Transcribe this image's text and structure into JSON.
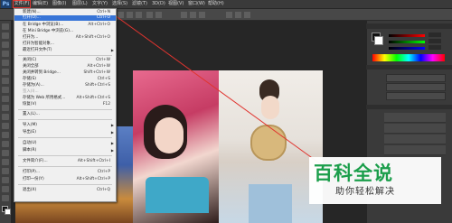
{
  "menubar": {
    "logo": "Ps",
    "items": [
      "文件(F)",
      "编辑(E)",
      "图像(I)",
      "图层(L)",
      "文字(Y)",
      "选择(S)",
      "滤镜(T)",
      "3D(D)",
      "视图(V)",
      "窗口(W)",
      "帮助(H)"
    ]
  },
  "file_menu": {
    "items": [
      {
        "label": "新建(N)...",
        "shortcut": "Ctrl+N"
      },
      {
        "label": "打开(O)...",
        "shortcut": "Ctrl+O"
      },
      {
        "label": "在 Bridge 中浏览(B)...",
        "shortcut": "Alt+Ctrl+O"
      },
      {
        "label": "在 Mini Bridge 中浏览(G)...",
        "shortcut": ""
      },
      {
        "label": "打开为...",
        "shortcut": "Alt+Shift+Ctrl+O"
      },
      {
        "label": "打开为智能对象...",
        "shortcut": ""
      },
      {
        "label": "最近打开文件(T)",
        "shortcut": ""
      },
      {
        "label": "关闭(C)",
        "shortcut": "Ctrl+W"
      },
      {
        "label": "关闭全部",
        "shortcut": "Alt+Ctrl+W"
      },
      {
        "label": "关闭并转到 Bridge...",
        "shortcut": "Shift+Ctrl+W"
      },
      {
        "label": "存储(S)",
        "shortcut": "Ctrl+S"
      },
      {
        "label": "存储为(A)...",
        "shortcut": "Shift+Ctrl+S"
      },
      {
        "label": "签入(I)...",
        "shortcut": ""
      },
      {
        "label": "存储为 Web 所用格式...",
        "shortcut": "Alt+Shift+Ctrl+S"
      },
      {
        "label": "恢复(V)",
        "shortcut": "F12"
      },
      {
        "label": "置入(L)...",
        "shortcut": ""
      },
      {
        "label": "导入(M)",
        "shortcut": ""
      },
      {
        "label": "导出(E)",
        "shortcut": ""
      },
      {
        "label": "自动(U)",
        "shortcut": ""
      },
      {
        "label": "脚本(R)",
        "shortcut": ""
      },
      {
        "label": "文件简介(F)...",
        "shortcut": "Alt+Shift+Ctrl+I"
      },
      {
        "label": "打印(P)...",
        "shortcut": "Ctrl+P"
      },
      {
        "label": "打印一份(Y)",
        "shortcut": "Alt+Shift+Ctrl+P"
      },
      {
        "label": "退出(X)",
        "shortcut": "Ctrl+Q"
      }
    ]
  },
  "watermark": {
    "title": "百科全说",
    "subtitle": "助你轻松解决"
  },
  "colors": {
    "highlight": "#3875d7",
    "annotation": "#e0342f",
    "watermark_green": "#1b9e4b"
  }
}
